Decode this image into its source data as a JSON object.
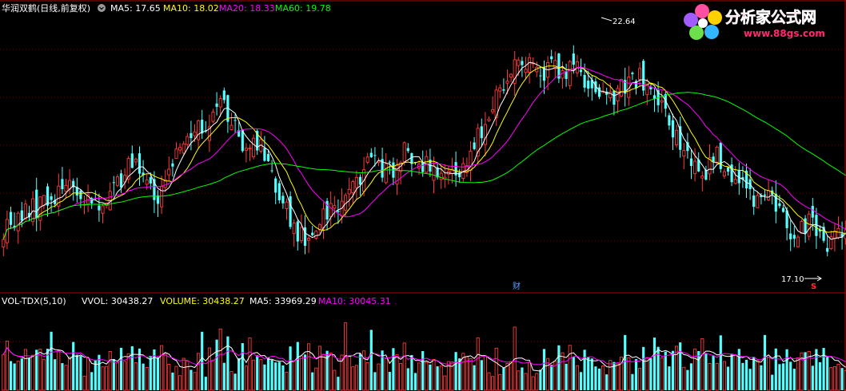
{
  "colors": {
    "background": "#000000",
    "up": "#ff3a3a",
    "down": "#54ffff",
    "ma5": "#ffffff",
    "ma10": "#ffff00",
    "ma20": "#ff00ff",
    "ma60": "#00ff00",
    "divider": "#b00000",
    "gridline": "#7a0000",
    "text": "#ffffff"
  },
  "header": {
    "stock_name": "华润双鹤(日线,前复权)",
    "ma5_label": "MA5: 17.65",
    "ma10_label": "MA10: 18.02",
    "ma20_label": "MA20: 18.33",
    "ma60_label": "MA60: 19.78"
  },
  "volume_header": {
    "indicator": "VOL-TDX(5,10)",
    "vvol": "VVOL: 30438.27",
    "volume": "VOLUME: 30438.27",
    "ma5": "MA5: 33969.29",
    "ma10": "MA10: 30045.31"
  },
  "annotations": {
    "high_label": "22.64",
    "low_label": "17.10",
    "finance_marker": "财",
    "s_marker": "S"
  },
  "logo": {
    "title": "分析家公式网",
    "url": "www.88gs.com"
  },
  "chart_data": [
    {
      "type": "candlestick",
      "price_range": [
        16.4,
        23.2
      ],
      "highest": 22.64,
      "lowest": 17.1,
      "close_anchors": [
        [
          0,
          17.7
        ],
        [
          30,
          18.3
        ],
        [
          55,
          18.9
        ],
        [
          75,
          18.2
        ],
        [
          95,
          19.0
        ],
        [
          110,
          19.5
        ],
        [
          125,
          18.4
        ],
        [
          140,
          19.4
        ],
        [
          155,
          20.4
        ],
        [
          165,
          20.3
        ],
        [
          180,
          21.0
        ],
        [
          195,
          20.0
        ],
        [
          210,
          19.8
        ],
        [
          225,
          18.5
        ],
        [
          245,
          17.4
        ],
        [
          265,
          18.2
        ],
        [
          280,
          18.5
        ],
        [
          300,
          19.5
        ],
        [
          320,
          19.1
        ],
        [
          330,
          19.8
        ],
        [
          345,
          19.3
        ],
        [
          365,
          19.0
        ],
        [
          380,
          19.4
        ],
        [
          400,
          21.0
        ],
        [
          420,
          22.0
        ],
        [
          445,
          21.8
        ],
        [
          470,
          21.9
        ],
        [
          490,
          21.0
        ],
        [
          505,
          21.3
        ],
        [
          520,
          21.6
        ],
        [
          540,
          20.8
        ],
        [
          555,
          19.8
        ],
        [
          570,
          18.9
        ],
        [
          585,
          19.6
        ],
        [
          600,
          19.0
        ],
        [
          615,
          18.5
        ],
        [
          630,
          18.4
        ],
        [
          645,
          17.6
        ],
        [
          660,
          17.8
        ],
        [
          675,
          17.2
        ],
        [
          689,
          17.65
        ]
      ],
      "ma_latest": {
        "ma5": 17.65,
        "ma10": 18.02,
        "ma20": 18.33,
        "ma60": 19.78
      }
    },
    {
      "type": "bar",
      "name": "VOLUME",
      "latest": 30438.27,
      "ma5": 33969.29,
      "ma10": 30045.31
    }
  ]
}
